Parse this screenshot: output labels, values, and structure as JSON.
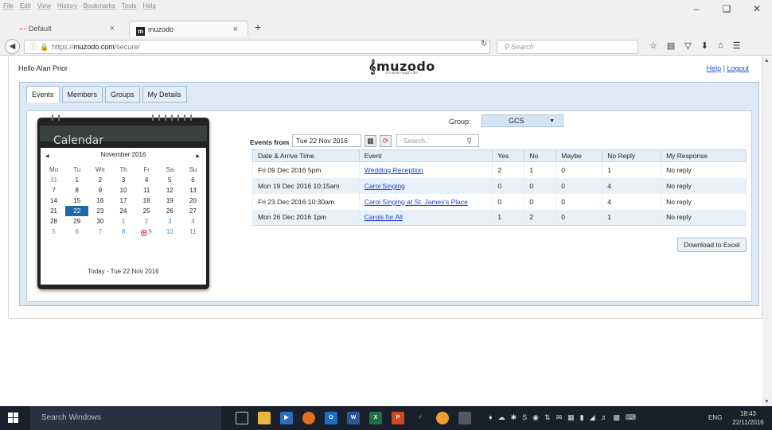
{
  "browser": {
    "menu": [
      "File",
      "Edit",
      "View",
      "History",
      "Bookmarks",
      "Tools",
      "Help"
    ],
    "tabs": [
      {
        "label": "Default"
      },
      {
        "label": "muzodo"
      }
    ],
    "url_prefix": "https://",
    "url_host": "muzodo.com",
    "url_path": "/secure/",
    "search_placeholder": "Search"
  },
  "header": {
    "greeting": "Hello Alan Prior",
    "logo_text": "muzodo",
    "logo_tagline": "it's what muzo's do!",
    "help_label": "Help",
    "separator": "|",
    "logout_label": "Logout"
  },
  "tabs": [
    "Events",
    "Members",
    "Groups",
    "My Details"
  ],
  "calendar": {
    "title": "Calendar",
    "month_label": "November 2016",
    "weekdays": [
      "Mo",
      "Tu",
      "We",
      "Th",
      "Fr",
      "Sa",
      "Su"
    ],
    "weeks": [
      [
        "31",
        "1",
        "2",
        "3",
        "4",
        "5",
        "6"
      ],
      [
        "7",
        "8",
        "9",
        "10",
        "11",
        "12",
        "13"
      ],
      [
        "14",
        "15",
        "16",
        "17",
        "18",
        "19",
        "20"
      ],
      [
        "21",
        "22",
        "23",
        "24",
        "25",
        "26",
        "27"
      ],
      [
        "28",
        "29",
        "30",
        "1",
        "2",
        "3",
        "4"
      ],
      [
        "5",
        "6",
        "7",
        "8",
        "9",
        "10",
        "11"
      ]
    ],
    "today_label": "Today - Tue 22 Nov 2016"
  },
  "filters": {
    "group_label": "Group:",
    "group_value": "GCS",
    "events_from_label": "Events from",
    "date_value": "Tue 22 Nov 2016",
    "search_placeholder": "Search.."
  },
  "events_table": {
    "headers": [
      "Date & Arrive Time",
      "Event",
      "Yes",
      "No",
      "Maybe",
      "No Reply",
      "My Response"
    ],
    "rows": [
      [
        "Fri 09 Dec 2016 5pm",
        "Wedding Reception",
        "2",
        "1",
        "0",
        "1",
        "No reply"
      ],
      [
        "Mon 19 Dec 2016 10:15am",
        "Carol Singing",
        "0",
        "0",
        "0",
        "4",
        "No reply"
      ],
      [
        "Fri 23 Dec 2016 10:30am",
        "Carol Singing at St. James's Place",
        "0",
        "0",
        "0",
        "4",
        "No reply"
      ],
      [
        "Mon 26 Dec 2016 1pm",
        "Carols for All",
        "1",
        "2",
        "0",
        "1",
        "No reply"
      ]
    ]
  },
  "download_label": "Download to Excel",
  "taskbar": {
    "search_placeholder": "Search Windows",
    "language": "ENG",
    "time": "18:43",
    "date": "22/11/2016"
  }
}
